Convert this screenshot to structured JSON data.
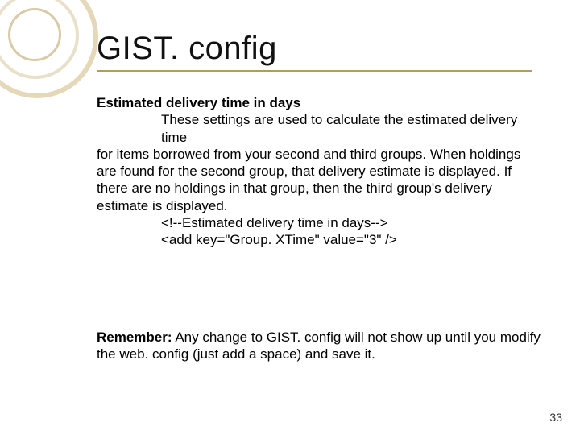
{
  "title": "GIST. config",
  "section_heading": "Estimated delivery time in days",
  "body_intro_indent": "These settings are used to calculate the estimated delivery time",
  "body_rest": "for items borrowed from your second and third groups. When holdings are found for the second group, that delivery estimate is displayed. If there are no holdings in that group, then the third group's delivery estimate is displayed.",
  "code_comment": "<!--Estimated delivery time in days-->",
  "code_line": "<add key=\"Group. XTime\" value=\"3\" />",
  "remember_label": "Remember:",
  "remember_text": " Any change to GIST. config will not show up until you modify the web. config (just add a space) and save it.",
  "page_number": "33"
}
